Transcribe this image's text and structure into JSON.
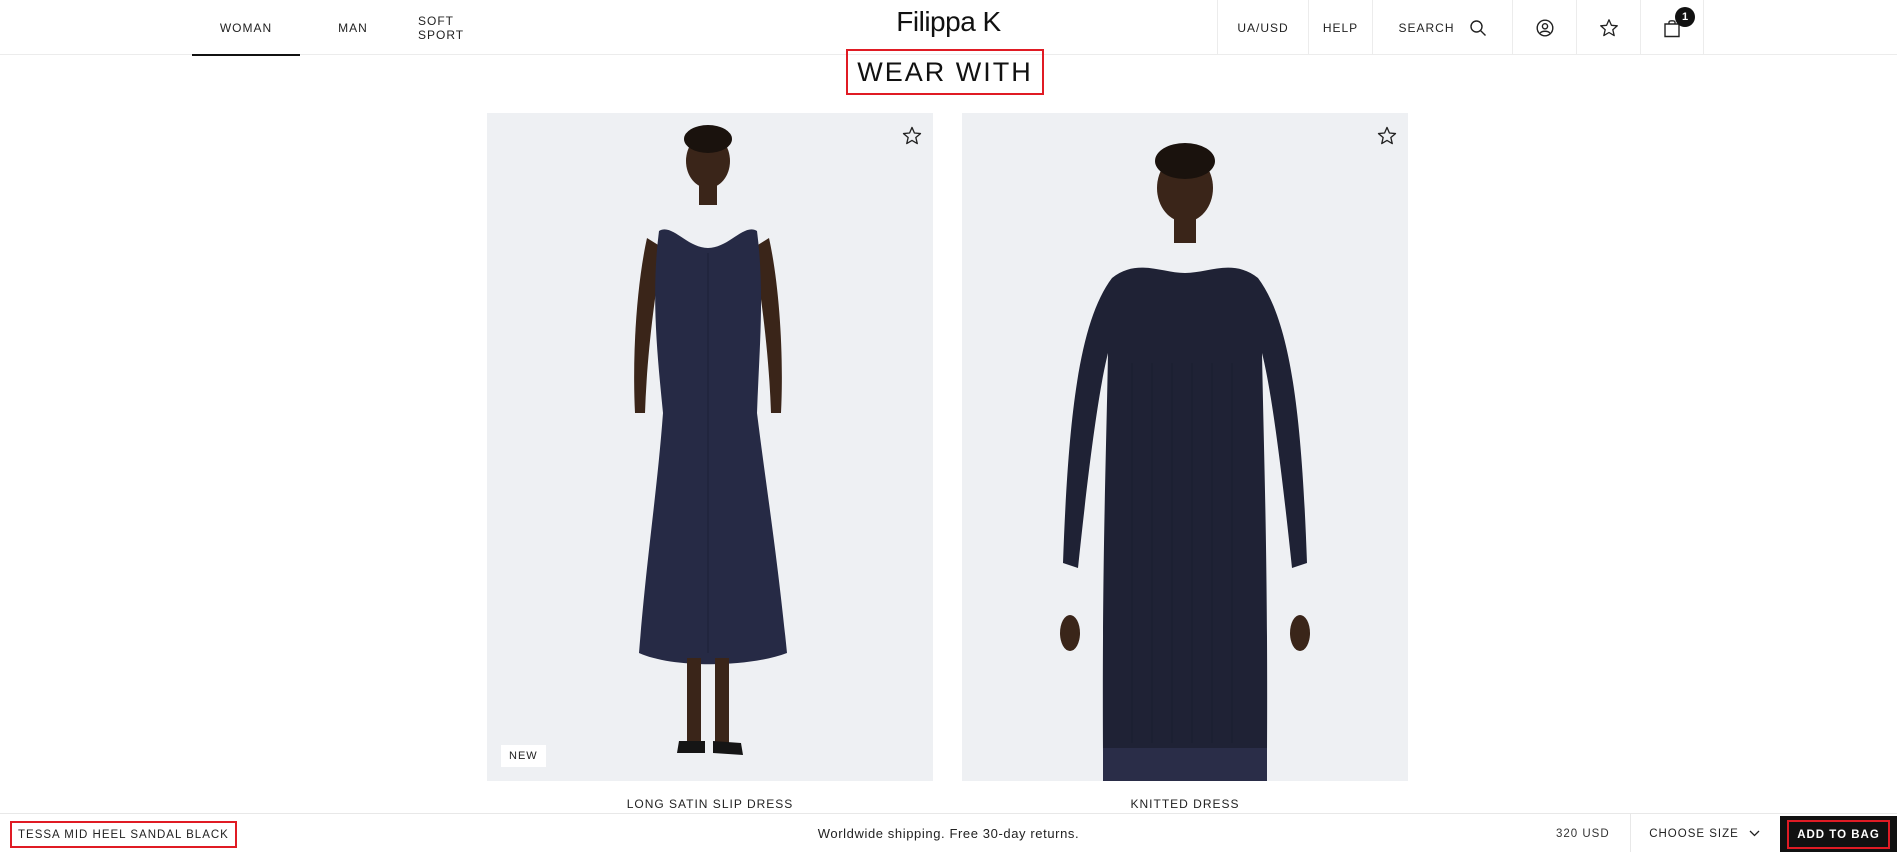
{
  "header": {
    "nav": [
      {
        "label": "WOMAN",
        "active": true
      },
      {
        "label": "MAN",
        "active": false
      },
      {
        "label": "SOFT SPORT",
        "active": false
      }
    ],
    "logo": "Filippa K",
    "currency": "UA/USD",
    "help": "HELP",
    "search_label": "SEARCH",
    "cart_count": "1",
    "icons": [
      "search-icon",
      "account-icon",
      "star-icon",
      "bag-icon"
    ]
  },
  "section": {
    "title": "WEAR WITH"
  },
  "products": [
    {
      "name": "LONG SATIN SLIP DRESS",
      "tag": "NEW"
    },
    {
      "name": "KNITTED DRESS",
      "tag": ""
    }
  ],
  "bottom_bar": {
    "product_name": "TESSA MID HEEL SANDAL BLACK",
    "shipping_text": "Worldwide shipping. Free 30-day returns.",
    "price": "320 USD",
    "size_label": "CHOOSE SIZE",
    "add_to_bag": "ADD TO BAG"
  },
  "colors": {
    "accent_outline": "#e01b24",
    "button_bg": "#111111",
    "photo_bg": "#eef0f3",
    "garment_navy": "#262a45"
  }
}
